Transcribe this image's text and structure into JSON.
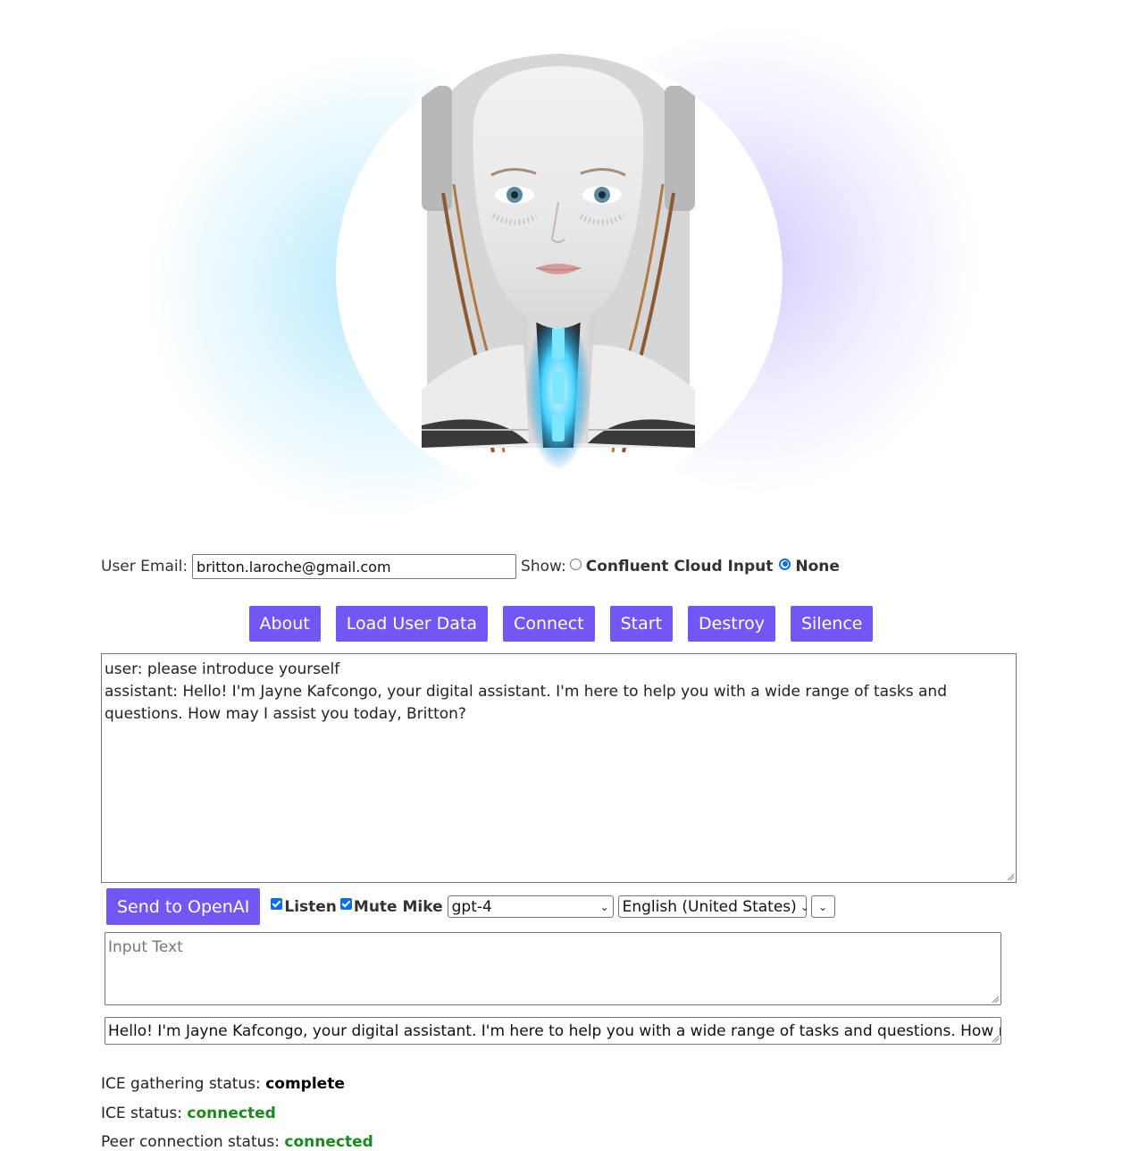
{
  "user_email": {
    "label": "User Email:",
    "value": "britton.laroche@gmail.com"
  },
  "show": {
    "label": "Show:",
    "options": [
      {
        "label": "Confluent Cloud Input",
        "checked": false
      },
      {
        "label": "None",
        "checked": true
      }
    ]
  },
  "toolbar": {
    "buttons": [
      "About",
      "Load User Data",
      "Connect",
      "Start",
      "Destroy",
      "Silence"
    ]
  },
  "chat_log": {
    "lines": [
      "user: please introduce yourself",
      "assistant: Hello! I'm Jayne Kafcongo, your digital assistant. I'm here to help you with a wide range of tasks and questions. How may I assist you today, Britton?"
    ]
  },
  "controls": {
    "send_label": "Send to OpenAI",
    "listen_label": "Listen",
    "listen_checked": true,
    "mute_label": "Mute Mike",
    "mute_checked": true,
    "model_value": "gpt-4",
    "language_value": "English (United States)",
    "voice_value": ""
  },
  "input_text": {
    "placeholder": "Input Text",
    "value": ""
  },
  "speak_text": {
    "value": "Hello! I'm Jayne Kafcongo, your digital assistant. I'm here to help you with a wide range of tasks and questions. How may I"
  },
  "status": {
    "ice_gathering_label": "ICE gathering status:",
    "ice_gathering_value": "complete",
    "ice_label": "ICE status:",
    "ice_value": "connected",
    "peer_label": "Peer connection status:",
    "peer_value": "connected"
  },
  "colors": {
    "button": "#7257f5",
    "status_connected": "#1a8a1a",
    "glow_left": "#78d7fa",
    "glow_right": "#aa96ff"
  }
}
